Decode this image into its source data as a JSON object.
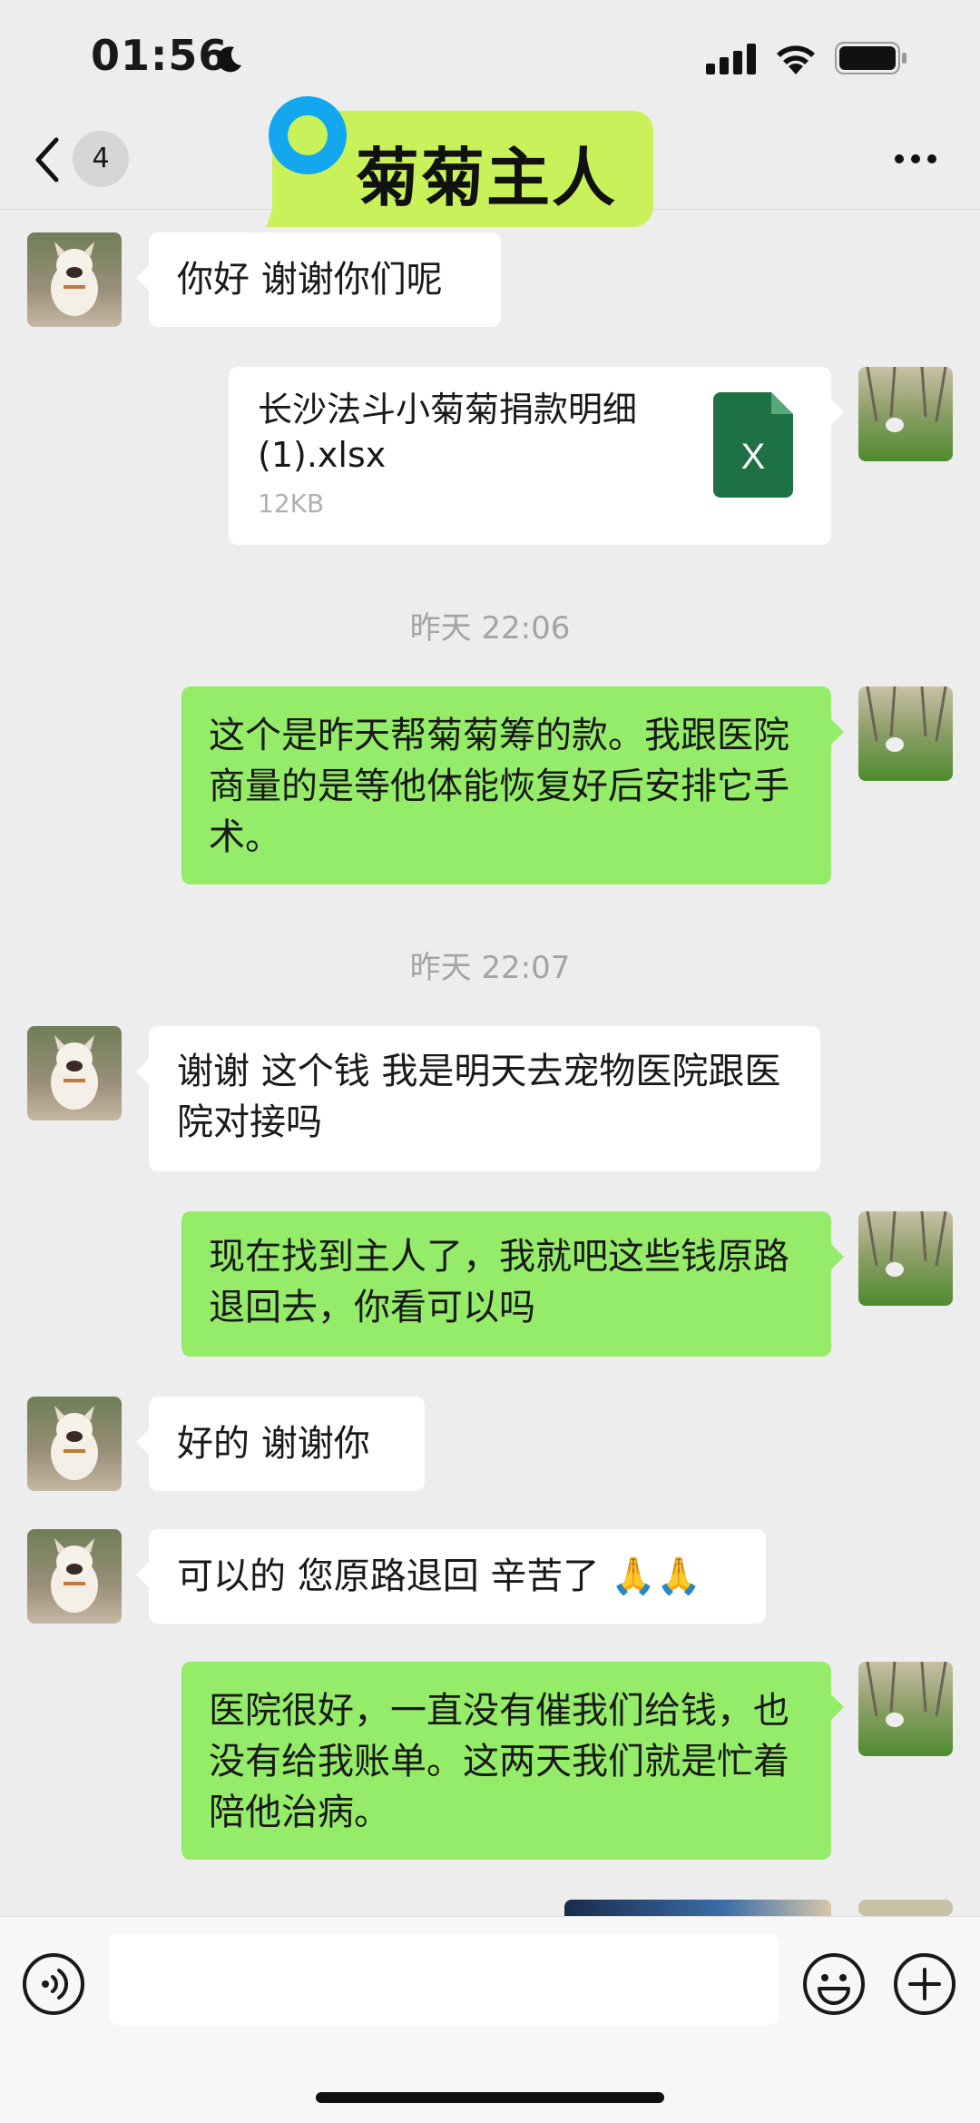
{
  "status_bar": {
    "time": "01:56"
  },
  "header": {
    "back_count": "4",
    "title": "菊菊主人"
  },
  "messages": [
    {
      "side": "in",
      "text": "你好 谢谢你们呢"
    },
    {
      "side": "out",
      "type": "file",
      "file_name": "长沙法斗小菊菊捐款明细 (1).xlsx",
      "file_size": "12KB",
      "file_icon_letter": "X"
    },
    {
      "side": "out",
      "text": "这个是昨天帮菊菊筹的款。我跟医院商量的是等他体能恢复好后安排它手术。"
    },
    {
      "side": "in",
      "text": "谢谢 这个钱 我是明天去宠物医院跟医院对接吗"
    },
    {
      "side": "out",
      "text": "现在找到主人了，我就吧这些钱原路退回去，你看可以吗"
    },
    {
      "side": "in",
      "text": "好的 谢谢你"
    },
    {
      "side": "in",
      "text": "可以的 您原路退回 辛苦了 🙏🙏"
    },
    {
      "side": "out",
      "text": "医院很好，一直没有催我们给钱，也没有给我账单。这两天我们就是忙着陪他治病。"
    }
  ],
  "timestamps": [
    "昨天 22:06",
    "昨天 22:07"
  ],
  "colors": {
    "outgoing_bubble": "#95ec69",
    "incoming_bubble": "#ffffff",
    "background": "#ededed",
    "title_highlight": "#c9f25a",
    "title_ring": "#13a7f0",
    "excel_green": "#1e7145"
  },
  "icons": [
    "back-icon",
    "more-icon",
    "voice-icon",
    "emoji-icon",
    "plus-icon",
    "excel-file-icon",
    "moon-icon",
    "signal-icon",
    "wifi-icon",
    "battery-icon"
  ]
}
